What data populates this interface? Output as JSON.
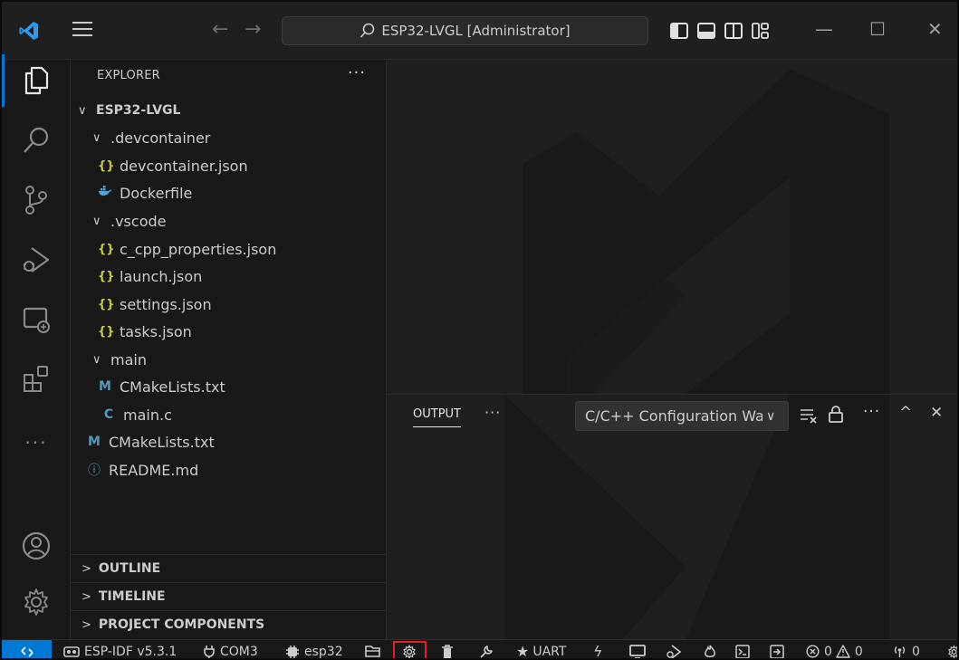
{
  "titlebar": {
    "search_text": "ESP32-LVGL [Administrator]",
    "nav_back": "←",
    "nav_forward": "→",
    "minimize": "—",
    "maximize": "☐",
    "close": "✕"
  },
  "explorer": {
    "title": "EXPLORER",
    "more": "···",
    "root": "ESP32-LVGL",
    "items": [
      {
        "label": ".devcontainer",
        "kind": "folder"
      },
      {
        "label": "devcontainer.json",
        "kind": "json"
      },
      {
        "label": "Dockerfile",
        "kind": "docker"
      },
      {
        "label": ".vscode",
        "kind": "folder"
      },
      {
        "label": "c_cpp_properties.json",
        "kind": "json"
      },
      {
        "label": "launch.json",
        "kind": "json"
      },
      {
        "label": "settings.json",
        "kind": "json"
      },
      {
        "label": "tasks.json",
        "kind": "json"
      },
      {
        "label": "main",
        "kind": "folder"
      },
      {
        "label": "CMakeLists.txt",
        "kind": "cmake"
      },
      {
        "label": "main.c",
        "kind": "c"
      },
      {
        "label": "CMakeLists.txt",
        "kind": "cmake"
      },
      {
        "label": "README.md",
        "kind": "info"
      }
    ],
    "icon_glyphs": {
      "json": "{}",
      "cmake": "M",
      "c": "C",
      "info": "ⓘ"
    },
    "sections": [
      "OUTLINE",
      "TIMELINE",
      "PROJECT COMPONENTS"
    ]
  },
  "panel": {
    "tab_output": "OUTPUT",
    "more": "···",
    "channel_select": "C/C++ Configuration Warnings",
    "actions_more": "···",
    "maximize": "^",
    "close": "✕"
  },
  "statusbar": {
    "idf_version": "ESP-IDF v5.3.1",
    "port": "COM3",
    "target": "esp32",
    "flash_method": "UART",
    "errors": "0",
    "warnings": "0",
    "ports_forwarded": "0"
  },
  "colors": {
    "accent": "#0078d4",
    "highlight_box": "#e02020",
    "json_icon": "#cbcb41",
    "file_icon_blue": "#519aba"
  }
}
